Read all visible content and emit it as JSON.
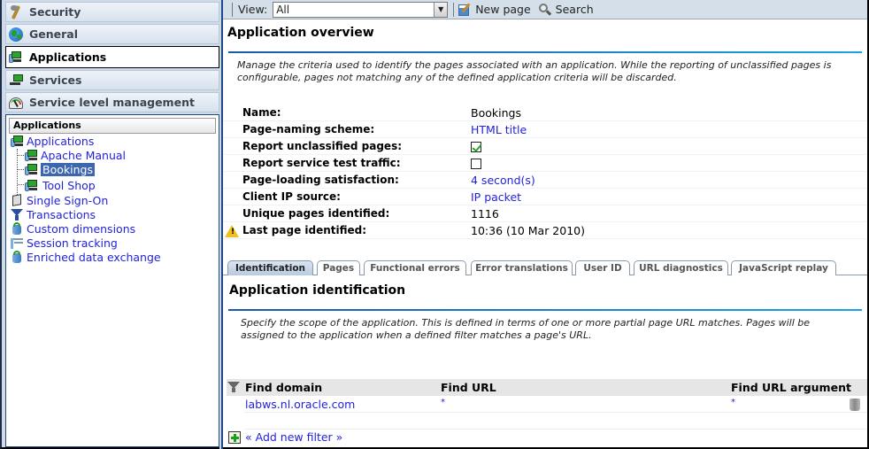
{
  "left_nav": {
    "accordion": [
      {
        "label": "Security",
        "icon": "key-icon"
      },
      {
        "label": "General",
        "icon": "globe-icon"
      },
      {
        "label": "Applications",
        "icon": "application-icon",
        "active": true
      },
      {
        "label": "Services",
        "icon": "service-icon"
      },
      {
        "label": "Service level management",
        "icon": "gauge-icon"
      }
    ],
    "tree_header": "Applications",
    "tree": [
      {
        "label": "Applications",
        "icon": "application-icon",
        "level": 0
      },
      {
        "label": "Apache Manual",
        "icon": "application-icon",
        "level": 1
      },
      {
        "label": "Bookings",
        "icon": "application-icon",
        "level": 1,
        "selected": true
      },
      {
        "label": "Tool Shop",
        "icon": "application-icon",
        "level": 1
      },
      {
        "label": "Single Sign-On",
        "icon": "door-icon",
        "level": 0
      },
      {
        "label": "Transactions",
        "icon": "funnel-icon",
        "level": 0
      },
      {
        "label": "Custom dimensions",
        "icon": "database-icon",
        "level": 0
      },
      {
        "label": "Session tracking",
        "icon": "session-icon",
        "level": 0
      },
      {
        "label": "Enriched data exchange",
        "icon": "database-icon",
        "level": 0
      }
    ]
  },
  "toolbar": {
    "view_label": "View:",
    "view_value": "All",
    "new_page": "New page",
    "search": "Search"
  },
  "overview": {
    "title": "Application overview",
    "description_1": "Manage the criteria used to identify the pages associated with an application. While the reporting of unclassified pages is",
    "description_2": "configurable, pages not matching any of the defined application criteria will be discarded.",
    "fields": [
      {
        "label": "Name:",
        "value": "Bookings",
        "type": "text"
      },
      {
        "label": "Page-naming scheme:",
        "value": "HTML title",
        "type": "link"
      },
      {
        "label": "Report unclassified pages:",
        "value": true,
        "type": "checkbox"
      },
      {
        "label": "Report service test traffic:",
        "value": false,
        "type": "checkbox"
      },
      {
        "label": "Page-loading satisfaction:",
        "value": "4 second(s)",
        "type": "link"
      },
      {
        "label": "Client IP source:",
        "value": "IP packet",
        "type": "link"
      },
      {
        "label": "Unique pages identified:",
        "value": "1116",
        "type": "text"
      },
      {
        "label": "Last page identified:",
        "value": "10:36 (10 Mar 2010)",
        "type": "text",
        "warning": true
      }
    ]
  },
  "tabs": [
    {
      "label": "Identification",
      "active": true
    },
    {
      "label": "Pages"
    },
    {
      "label": "Functional errors"
    },
    {
      "label": "Error translations"
    },
    {
      "label": "User ID"
    },
    {
      "label": "URL diagnostics"
    },
    {
      "label": "JavaScript replay"
    }
  ],
  "identification": {
    "title": "Application identification",
    "description_1": "Specify the scope of the application. This is defined in terms of one or more partial page URL matches. Pages will be",
    "description_2": "assigned to the application when a defined filter matches a page's URL.",
    "columns": [
      "Find domain",
      "Find URL",
      "Find URL argument"
    ],
    "rows": [
      {
        "domain": "labws.nl.oracle.com",
        "url": "*",
        "argument": "*"
      }
    ],
    "add_filter": "« Add new filter »"
  }
}
